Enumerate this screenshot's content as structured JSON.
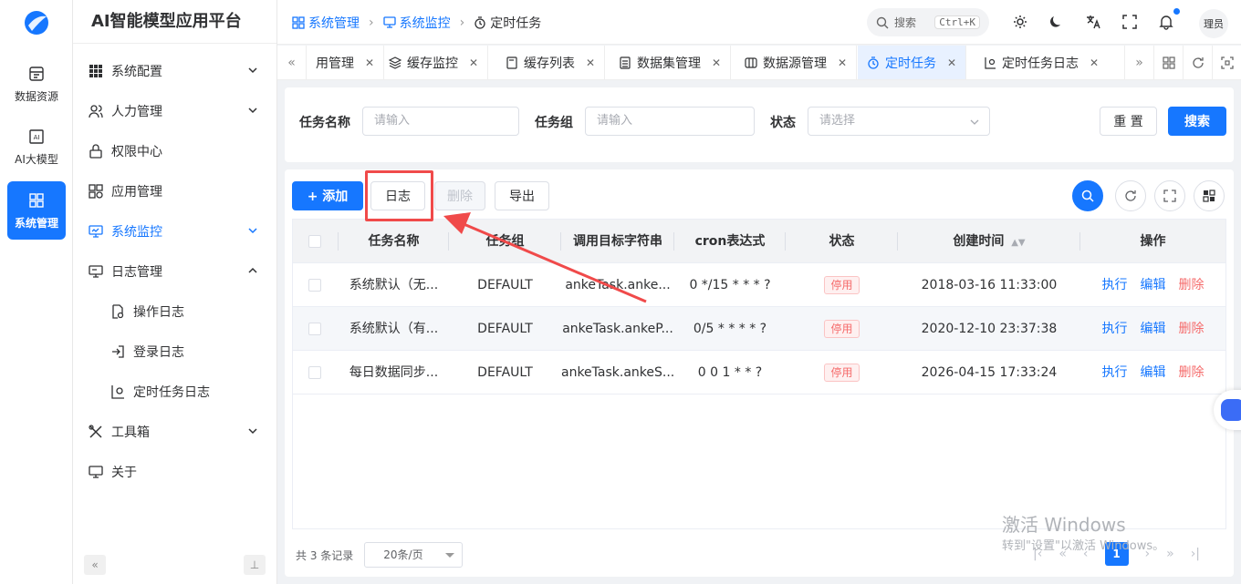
{
  "app": {
    "title": "AI智能模型应用平台"
  },
  "rail": [
    {
      "label": "数据资源",
      "icon": "database-icon"
    },
    {
      "label": "AI大模型",
      "icon": "ai-icon"
    },
    {
      "label": "系统管理",
      "icon": "system-icon",
      "active": true
    }
  ],
  "menu": [
    {
      "label": "系统配置",
      "icon": "grid-icon",
      "arrow": "down"
    },
    {
      "label": "人力管理",
      "icon": "users-icon",
      "arrow": "down"
    },
    {
      "label": "权限中心",
      "icon": "lock-icon"
    },
    {
      "label": "应用管理",
      "icon": "apps-icon"
    },
    {
      "label": "系统监控",
      "icon": "monitor-icon",
      "arrow": "down",
      "active": true
    },
    {
      "label": "日志管理",
      "icon": "log-icon",
      "arrow": "up"
    },
    {
      "label": "操作日志",
      "icon": "doc-search-icon",
      "sub": true
    },
    {
      "label": "登录日志",
      "icon": "login-icon",
      "sub": true
    },
    {
      "label": "定时任务日志",
      "icon": "chart-icon",
      "sub": true
    },
    {
      "label": "工具箱",
      "icon": "tools-icon",
      "arrow": "down"
    },
    {
      "label": "关于",
      "icon": "about-icon"
    }
  ],
  "breadcrumb": [
    "系统管理",
    "系统监控",
    "定时任务"
  ],
  "search": {
    "placeholder": "搜索",
    "shortcut": "Ctrl+K"
  },
  "user": {
    "avatar_text": "理员"
  },
  "tabs": [
    {
      "label": "用管理"
    },
    {
      "label": "缓存监控"
    },
    {
      "label": "缓存列表"
    },
    {
      "label": "数据集管理"
    },
    {
      "label": "数据源管理"
    },
    {
      "label": "定时任务",
      "active": true
    },
    {
      "label": "定时任务日志"
    }
  ],
  "filter": {
    "task_name_label": "任务名称",
    "task_name_placeholder": "请输入",
    "task_group_label": "任务组",
    "task_group_placeholder": "请输入",
    "status_label": "状态",
    "status_placeholder": "请选择",
    "reset": "重 置",
    "search": "搜索"
  },
  "toolbar": {
    "add": "+ 添加",
    "log": "日志",
    "delete": "删除",
    "export": "导出"
  },
  "table": {
    "columns": [
      "任务名称",
      "任务组",
      "调用目标字符串",
      "cron表达式",
      "状态",
      "创建时间",
      "操作"
    ],
    "rows": [
      {
        "name": "系统默认（无...",
        "group": "DEFAULT",
        "target": "ankeTask.anke...",
        "cron": "0 */15 * * * ?",
        "status": "停用",
        "created": "2018-03-16 11:33:00"
      },
      {
        "name": "系统默认（有...",
        "group": "DEFAULT",
        "target": "ankeTask.ankeP...",
        "cron": "0/5 * * * * ?",
        "status": "停用",
        "created": "2020-12-10 23:37:38"
      },
      {
        "name": "每日数据同步...",
        "group": "DEFAULT",
        "target": "ankeTask.ankeS...",
        "cron": "0 0 1 * * ?",
        "status": "停用",
        "created": "2026-04-15 17:33:24"
      }
    ],
    "actions": [
      "执行",
      "编辑",
      "删除"
    ]
  },
  "pagination": {
    "total": "共 3 条记录",
    "page_size": "20条/页",
    "current": "1"
  },
  "watermark": {
    "line1": "激活 Windows",
    "line2": "转到\"设置\"以激活 Windows。"
  }
}
